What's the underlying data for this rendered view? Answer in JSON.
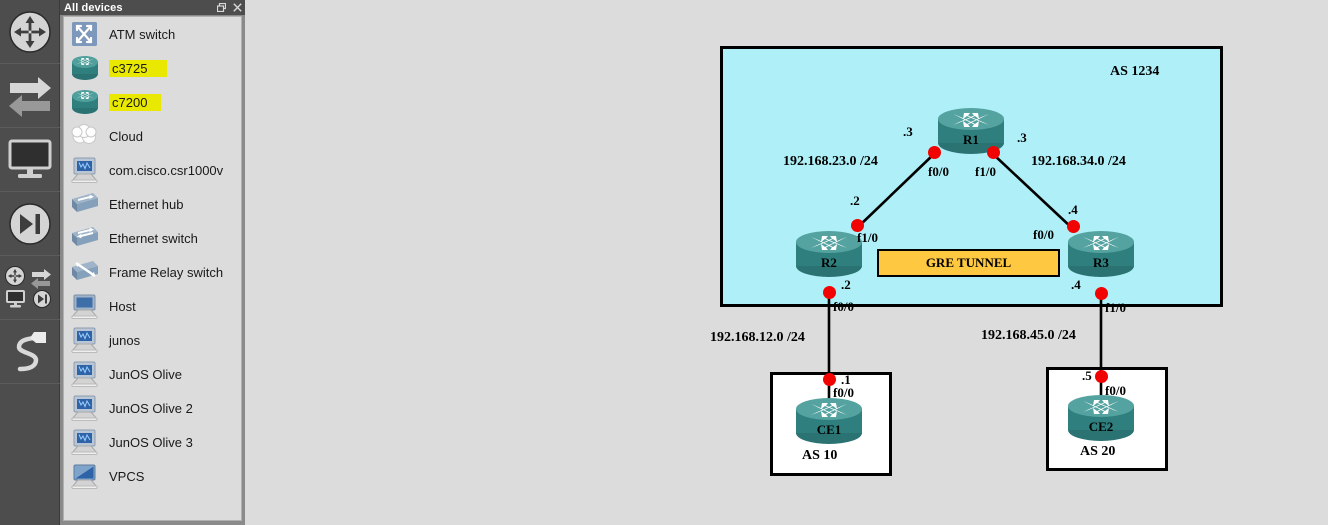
{
  "panel": {
    "title": "All devices",
    "float_icon": "restore-icon",
    "close_icon": "close-icon",
    "items": [
      {
        "label": "ATM switch",
        "icon": "atm-switch-icon",
        "highlight": false
      },
      {
        "label": "c3725",
        "icon": "router-icon",
        "highlight": true
      },
      {
        "label": "c7200",
        "icon": "router-icon",
        "highlight": true
      },
      {
        "label": "Cloud",
        "icon": "cloud-icon",
        "highlight": false
      },
      {
        "label": "com.cisco.csr1000v",
        "icon": "qemu-vm-icon",
        "highlight": false
      },
      {
        "label": "Ethernet hub",
        "icon": "hub-icon",
        "highlight": false
      },
      {
        "label": "Ethernet switch",
        "icon": "switch-icon",
        "highlight": false
      },
      {
        "label": "Frame Relay switch",
        "icon": "frame-relay-icon",
        "highlight": false
      },
      {
        "label": "Host",
        "icon": "host-icon",
        "highlight": false
      },
      {
        "label": "junos",
        "icon": "qemu-vm-icon",
        "highlight": false
      },
      {
        "label": "JunOS Olive",
        "icon": "qemu-vm-icon",
        "highlight": false
      },
      {
        "label": "JunOS Olive 2",
        "icon": "qemu-vm-icon",
        "highlight": false
      },
      {
        "label": "JunOS Olive 3",
        "icon": "qemu-vm-icon",
        "highlight": false
      },
      {
        "label": "VPCS",
        "icon": "vpcs-icon",
        "highlight": false
      }
    ]
  },
  "toolbar": {
    "buttons": [
      {
        "name": "routers-button",
        "icon": "router-icon"
      },
      {
        "name": "switches-button",
        "icon": "switch-icon"
      },
      {
        "name": "end-devices-button",
        "icon": "monitor-icon"
      },
      {
        "name": "security-devices-button",
        "icon": "firewall-icon"
      },
      {
        "name": "all-devices-button",
        "icon": "all-devices-icon"
      },
      {
        "name": "add-link-button",
        "icon": "link-cable-icon"
      }
    ]
  },
  "topology": {
    "as_box_label": "AS 1234",
    "gre_tunnel_label": "GRE TUNNEL",
    "nodes": {
      "r1": "R1",
      "r2": "R2",
      "r3": "R3",
      "ce1": "CE1",
      "ce2": "CE2"
    },
    "ce_boxes": {
      "ce1_as": "AS 10",
      "ce2_as": "AS 20"
    },
    "networks": {
      "r1_r2": "192.168.23.0 /24",
      "r1_r3": "192.168.34.0 /24",
      "r2_ce1": "192.168.12.0 /24",
      "r3_ce2": "192.168.45.0 /24"
    },
    "interfaces": {
      "r1_f00": "f0/0",
      "r1_f10": "f1/0",
      "r2_f10": "f1/0",
      "r2_f00": "f0/0",
      "r3_f00": "f0/0",
      "r3_f10": "f1/0",
      "ce1_f00": "f0/0",
      "ce2_f00": "f0/0"
    },
    "host_ids": {
      "r1_left": ".3",
      "r1_right": ".3",
      "r2_up": ".2",
      "r2_down": ".2",
      "r3_up": ".4",
      "r3_down": ".4",
      "ce1": ".1",
      "ce2": ".5"
    }
  },
  "colors": {
    "as_fill": "#aff0f8",
    "gre_fill": "#ffc841",
    "link_dot": "#f00301",
    "router_body": "#2f7f7f",
    "highlight": "#e8e800",
    "canvas_bg": "#dcdcdc",
    "toolbar_bg": "#4d4d4d"
  }
}
